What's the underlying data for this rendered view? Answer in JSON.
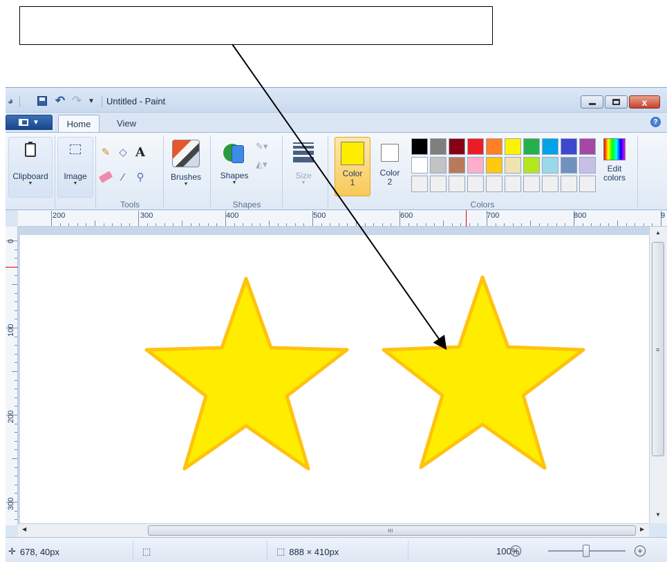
{
  "callout": {
    "text": ""
  },
  "window": {
    "title": "Untitled - Paint",
    "quick_access": {
      "icons": [
        "paint-app-icon",
        "save-icon",
        "undo-icon",
        "redo-icon",
        "customize-dropdown-icon"
      ]
    },
    "controls": {
      "close": "x"
    }
  },
  "tabs": [
    {
      "label": "Home",
      "active": true
    },
    {
      "label": "View",
      "active": false
    }
  ],
  "ribbon": {
    "groups": {
      "tools": "Tools",
      "shapes": "Shapes",
      "colors": "Colors"
    },
    "clipboard_label": "Clipboard",
    "image_label": "Image",
    "brushes_label": "Brushes",
    "shapes_label": "Shapes",
    "size_label": "Size",
    "color1": {
      "line1": "Color",
      "line2": "1",
      "value": "#ffed00"
    },
    "color2": {
      "line1": "Color",
      "line2": "2",
      "value": "#ffffff"
    },
    "edit_colors": {
      "line1": "Edit",
      "line2": "colors"
    },
    "palette": [
      "#000000",
      "#7f7f7f",
      "#880015",
      "#ed1c24",
      "#ff7f27",
      "#fff200",
      "#22b14c",
      "#00a2e8",
      "#3f48cc",
      "#a349a4",
      "#ffffff",
      "#c3c3c3",
      "#b97a57",
      "#ffaec9",
      "#ffc90e",
      "#efe4b0",
      "#b5e61d",
      "#99d9ea",
      "#7092be",
      "#c8bfe7",
      "#f0f0f0",
      "#f0f0f0",
      "#f0f0f0",
      "#f0f0f0",
      "#f0f0f0",
      "#f0f0f0",
      "#f0f0f0",
      "#f0f0f0",
      "#f0f0f0",
      "#f0f0f0"
    ]
  },
  "rulers": {
    "horizontal": [
      "200",
      "300",
      "400",
      "500",
      "600",
      "700",
      "800",
      "9"
    ],
    "vertical": [
      "0",
      "100",
      "200",
      "300"
    ]
  },
  "canvas": {
    "background": "#ffffff",
    "shapes": [
      {
        "type": "star",
        "fill": "#ffed00",
        "outline": "#ffc20e"
      },
      {
        "type": "star",
        "fill": "#ffed00",
        "outline": "#ffc20e"
      }
    ]
  },
  "status": {
    "cursor_position": "678, 40px",
    "canvas_size": "888 × 410px",
    "zoom": "100%"
  }
}
